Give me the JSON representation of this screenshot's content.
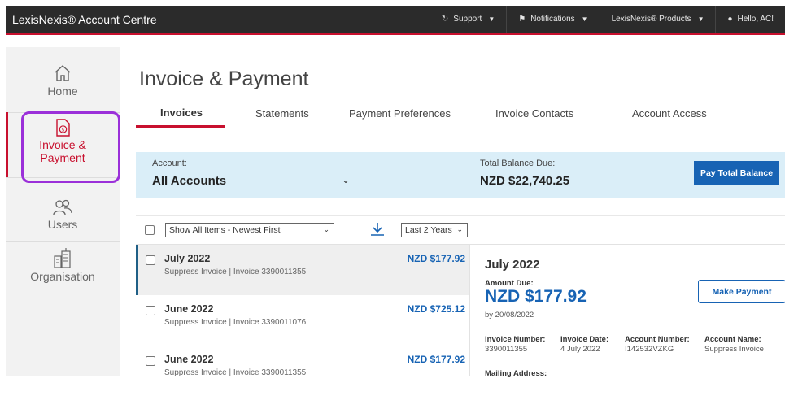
{
  "header": {
    "brand": "LexisNexis® Account Centre",
    "nav": [
      {
        "label": "Support",
        "icon": "support-icon"
      },
      {
        "label": "Notifications",
        "icon": "flag-icon"
      },
      {
        "label": "LexisNexis® Products",
        "icon": ""
      },
      {
        "label": "Hello, AC!",
        "icon": "user-icon"
      }
    ]
  },
  "sidebar": {
    "items": [
      {
        "label": "Home",
        "icon": "home-icon"
      },
      {
        "label": "Invoice &\nPayment",
        "icon": "invoice-icon"
      },
      {
        "label": "Users",
        "icon": "users-icon"
      },
      {
        "label": "Organisation",
        "icon": "building-icon"
      }
    ]
  },
  "page": {
    "title": "Invoice & Payment",
    "tabs": [
      "Invoices",
      "Statements",
      "Payment Preferences",
      "Invoice Contacts",
      "Account Access"
    ]
  },
  "account": {
    "account_label": "Account:",
    "account_value": "All Accounts",
    "balance_label": "Total Balance Due:",
    "balance_value": "NZD $22,740.25",
    "pay_total_label": "Pay Total Balance"
  },
  "toolbar": {
    "filter_value": "Show All Items - Newest First",
    "range_value": "Last 2 Years"
  },
  "invoices": [
    {
      "title": "July 2022",
      "sub": "Suppress Invoice | Invoice 3390011355",
      "amount": "NZD $177.92"
    },
    {
      "title": "June 2022",
      "sub": "Suppress Invoice | Invoice 3390011076",
      "amount": "NZD $725.12"
    },
    {
      "title": "June 2022",
      "sub": "Suppress Invoice | Invoice 3390011355",
      "amount": "NZD $177.92"
    }
  ],
  "detail": {
    "title": "July 2022",
    "amount_due_label": "Amount Due:",
    "amount_due": "NZD $177.92",
    "due_by": "by 20/08/2022",
    "make_payment_label": "Make Payment",
    "fields": [
      {
        "label": "Invoice Number:",
        "value": "3390011355"
      },
      {
        "label": "Invoice Date:",
        "value": "4 July 2022"
      },
      {
        "label": "Account Number:",
        "value": "I142532VZKG"
      },
      {
        "label": "Account Name:",
        "value": "Suppress Invoice"
      }
    ],
    "mailing_label": "Mailing Address:"
  },
  "colors": {
    "accent": "#c8102e",
    "primary": "#1763b4",
    "highlight": "#9b30d9"
  }
}
